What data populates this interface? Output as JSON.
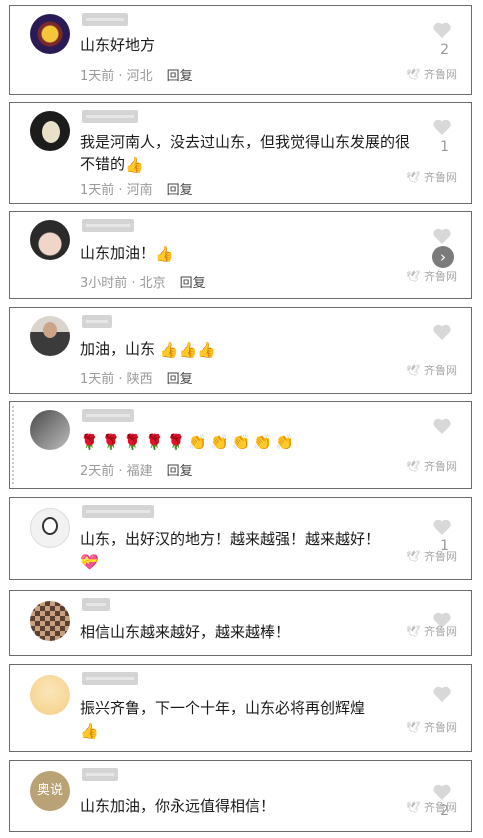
{
  "watermark": "齐鲁网",
  "comments": [
    {
      "text": "山东好地方",
      "emoji": "",
      "time": "1天前 · 河北",
      "reply": "回复",
      "likes": "2"
    },
    {
      "text": "我是河南人，没去过山东，但我觉得山东发展的很不错的",
      "emoji": "👍",
      "time": "1天前 · 河南",
      "reply": "回复",
      "likes": "1"
    },
    {
      "text": "山东加油！",
      "emoji": "👍",
      "time": "3小时前 · 北京",
      "reply": "回复",
      "likes": ""
    },
    {
      "text": "加油，山东",
      "emoji": "👍👍👍",
      "time": "1天前 · 陕西",
      "reply": "回复",
      "likes": ""
    },
    {
      "text": "",
      "emoji": "🌹🌹🌹🌹🌹👏👏👏👏👏",
      "time": "2天前 · 福建",
      "reply": "回复",
      "likes": ""
    },
    {
      "text": "山东，出好汉的地方！越来越强！越来越好！",
      "emoji": "💝",
      "time": "",
      "reply": "",
      "likes": "1"
    },
    {
      "text": "相信山东越来越好，越来越棒！",
      "emoji": "",
      "time": "",
      "reply": "",
      "likes": ""
    },
    {
      "text": "振兴齐鲁，下一个十年，山东必将再创辉煌",
      "emoji": "👍",
      "time": "",
      "reply": "",
      "likes": ""
    },
    {
      "text": "山东加油，你永远值得相信！",
      "emoji": "",
      "time": "",
      "reply": "",
      "likes": "2"
    }
  ],
  "avatar_text_9": "奥说",
  "icons": {
    "like": "heart-icon",
    "next": "chevron-right-icon",
    "watermark": "bird-logo-icon"
  }
}
